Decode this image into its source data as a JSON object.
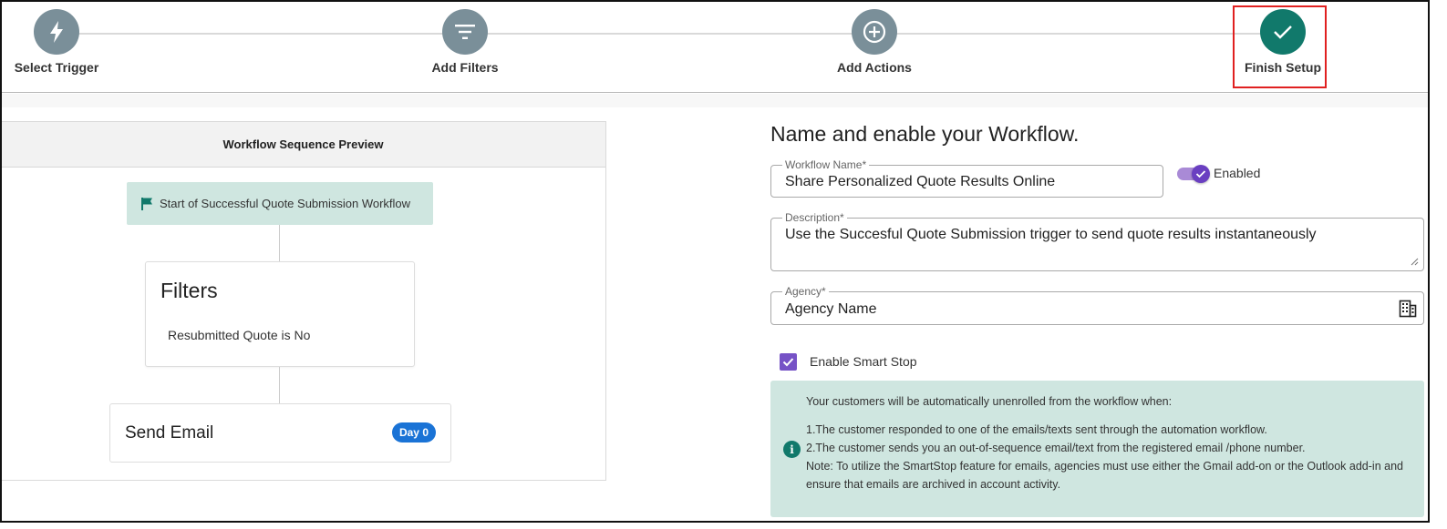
{
  "stepper": {
    "steps": [
      {
        "label": "Select Trigger",
        "icon": "lightning-icon",
        "state": "complete"
      },
      {
        "label": "Add Filters",
        "icon": "filter-icon",
        "state": "complete"
      },
      {
        "label": "Add Actions",
        "icon": "plus-circle-icon",
        "state": "complete"
      },
      {
        "label": "Finish Setup",
        "icon": "check-icon",
        "state": "active"
      }
    ],
    "colors": {
      "default": "#7a8f99",
      "active": "#11796b",
      "highlight_border": "#e02020"
    }
  },
  "preview": {
    "header": "Workflow Sequence Preview",
    "start_node": {
      "label": "Start of Successful Quote Submission Workflow",
      "icon": "flag-icon"
    },
    "filters_card": {
      "title": "Filters",
      "condition": "Resubmitted Quote is No"
    },
    "email_card": {
      "title": "Send Email",
      "badge": "Day 0"
    }
  },
  "form": {
    "title": "Name and enable your Workflow.",
    "workflow_name": {
      "label": "Workflow Name*",
      "value": "Share Personalized Quote Results Online"
    },
    "enabled": {
      "label": "Enabled",
      "on": true
    },
    "description": {
      "label": "Description*",
      "value": "Use the Succesful Quote Submission trigger to send quote results instantaneously"
    },
    "agency": {
      "label": "Agency*",
      "value": "Agency Name",
      "icon": "building-icon"
    },
    "smart_stop": {
      "label": "Enable Smart Stop",
      "checked": true
    },
    "info": {
      "intro": "Your customers will be automatically unenrolled from the workflow when:",
      "point1": "1.The customer responded to one of the emails/texts sent through the automation workflow.",
      "point2": "2.The customer sends you an out-of-sequence email/text from the registered email /phone number.",
      "note": "Note: To utilize the SmartStop feature for emails, agencies must use either the Gmail add-on or the Outlook add-in and ensure that emails are archived in account activity."
    }
  },
  "colors": {
    "accent_purple": "#7652c6",
    "teal": "#11796b",
    "teal_light": "#cfe6e0",
    "badge_blue": "#1a73d6"
  }
}
